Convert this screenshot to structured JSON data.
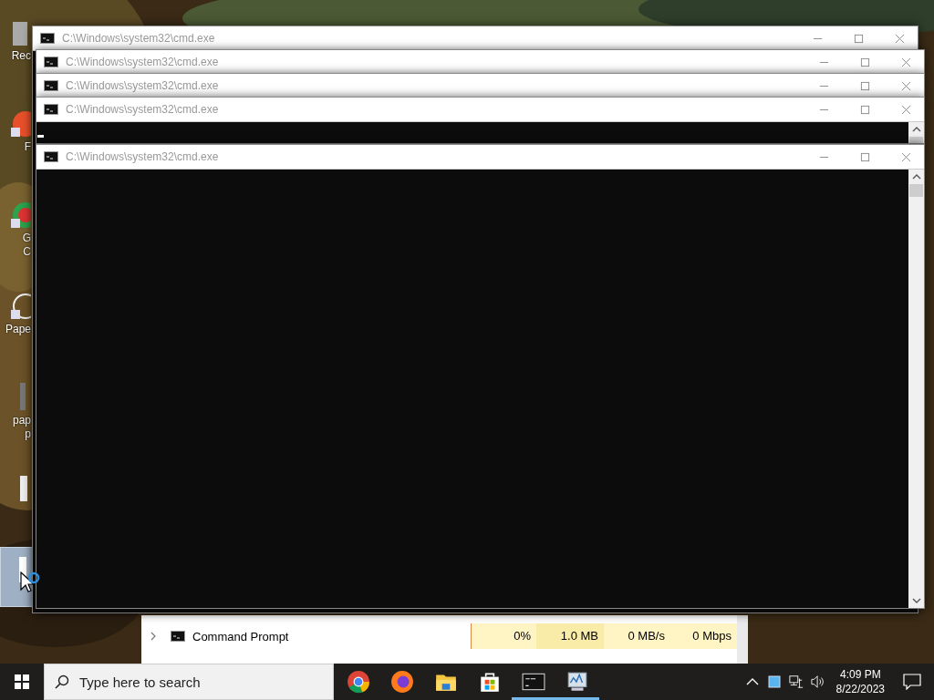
{
  "desktop": {
    "icons": [
      {
        "lines": [
          "Rec"
        ],
        "selected": false
      },
      {
        "lines": [
          "F"
        ],
        "selected": false
      },
      {
        "lines": [
          "G",
          "C"
        ],
        "selected": false
      },
      {
        "lines": [
          "Pape"
        ],
        "selected": false
      },
      {
        "lines": [
          "pap",
          "p"
        ],
        "selected": false
      },
      {
        "selected": false
      },
      {
        "selected": true
      }
    ]
  },
  "task_manager": {
    "rows": [
      {
        "name": "Command Prompt",
        "cpu": "0%",
        "memory": "1.0 MB",
        "disk": "0 MB/s",
        "network": "0 Mbps"
      }
    ]
  },
  "windows": [
    {
      "title": "C:\\Windows\\system32\\cmd.exe",
      "active": false,
      "cursor": false
    },
    {
      "title": "C:\\Windows\\system32\\cmd.exe",
      "active": false,
      "cursor": false
    },
    {
      "title": "C:\\Windows\\system32\\cmd.exe",
      "active": false,
      "cursor": false
    },
    {
      "title": "C:\\Windows\\system32\\cmd.exe",
      "active": false,
      "cursor": true
    },
    {
      "title": "C:\\Windows\\system32\\cmd.exe",
      "active": false,
      "cursor": false
    }
  ],
  "taskbar": {
    "search": {
      "placeholder": "Type here to search"
    },
    "apps": [
      {
        "kind": "chrome",
        "running": false
      },
      {
        "kind": "firefox",
        "running": false
      },
      {
        "kind": "explorer",
        "running": false
      },
      {
        "kind": "store",
        "running": false
      },
      {
        "kind": "cmd",
        "running": true
      },
      {
        "kind": "taskmgr",
        "running": true
      }
    ],
    "time": "4:09 PM",
    "date": "8/22/2023"
  }
}
